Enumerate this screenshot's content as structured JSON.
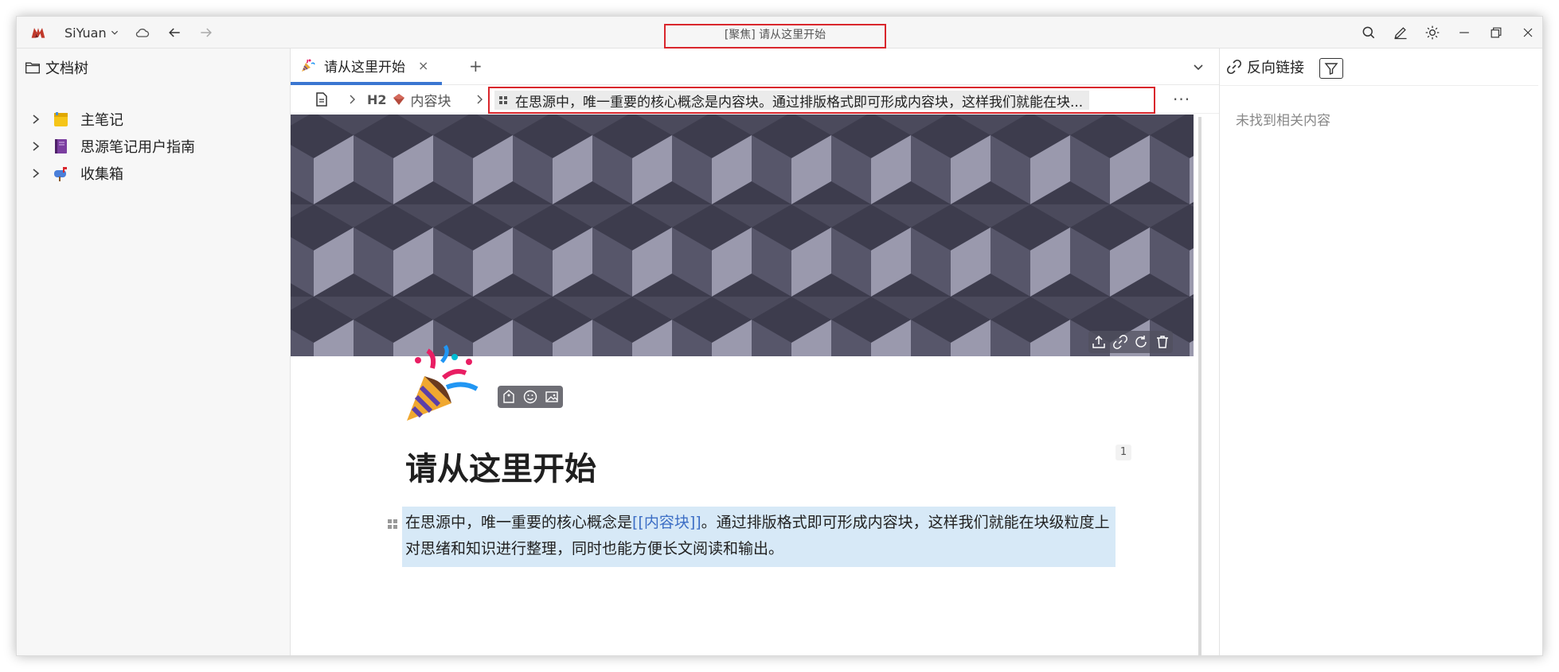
{
  "titlebar": {
    "workspace": "SiYuan",
    "window_title": "[聚焦] 请从这里开始"
  },
  "file_tree": {
    "header": "文档树",
    "items": [
      {
        "label": "主笔记",
        "icon": "notebook-yellow-icon"
      },
      {
        "label": "思源笔记用户指南",
        "icon": "book-purple-icon"
      },
      {
        "label": "收集箱",
        "icon": "mailbox-icon"
      }
    ]
  },
  "tab": {
    "label": "请从这里开始",
    "close": "×",
    "add": "+"
  },
  "breadcrumb": {
    "heading_marker": "H2",
    "heading_label": "内容块",
    "focused_block": "在思源中，唯一重要的核心概念是内容块。通过排版格式即可形成内容块，这样我们就能在块...",
    "more": "···"
  },
  "document": {
    "title": "请从这里开始",
    "ref_count": "1",
    "paragraph_before": "在思源中，唯一重要的核心概念是",
    "paragraph_ref": "[[内容块]]",
    "paragraph_after": "。通过排版格式即可形成内容块，这样我们就能在块级粒度上对思绪和知识进行整理，同时也能方便长文阅读和输出。"
  },
  "backlinks": {
    "header": "反向链接",
    "empty_text": "未找到相关内容"
  },
  "colors": {
    "accent": "#3a76d1",
    "focus_outline": "#d9262c",
    "block_highlight": "#d7e9f7",
    "ref_link": "#3c6ec5"
  }
}
